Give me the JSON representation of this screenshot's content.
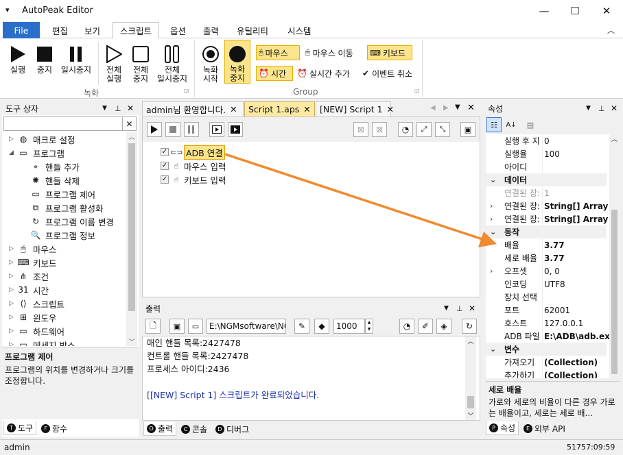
{
  "window": {
    "title": "AutoPeak Editor",
    "menu_glyph": "▾",
    "minimize": "—",
    "maximize": "☐",
    "close": "✕"
  },
  "ribbon_tabs": [
    "File",
    "편집",
    "보기",
    "스크립트",
    "옵션",
    "출력",
    "유틸리티",
    "시스템"
  ],
  "ribbon_collapse": "︿",
  "ribbon": {
    "run": "실행",
    "stop": "중지",
    "pause": "일시중지",
    "run_all": [
      "전체",
      "실행"
    ],
    "stop_all": [
      "전체",
      "중지"
    ],
    "pause_all": [
      "전체",
      "일시중지"
    ],
    "rec_start": [
      "녹화",
      "시작"
    ],
    "rec_stop": [
      "녹화",
      "중지"
    ],
    "group_record": "녹화",
    "mouse": "마우스",
    "mouse_move": "마우스 이동",
    "keyboard": "키보드",
    "time": "시간",
    "realtime_add": "실시간 추가",
    "event_cancel": "이벤트 취소",
    "group_group": "Group"
  },
  "toolbox": {
    "title": "도구 상자",
    "search_value": "",
    "items": [
      {
        "label": "매크로 설정",
        "level": 0,
        "arrow": "▷",
        "icon": "globe-icon",
        "glyph": "◍"
      },
      {
        "label": "프로그램",
        "level": 0,
        "arrow": "◢",
        "icon": "monitor-icon",
        "glyph": "▭"
      },
      {
        "label": "핸들 추가",
        "level": 1,
        "arrow": "",
        "icon": "crosshair-icon",
        "glyph": "⌖"
      },
      {
        "label": "핸들 삭제",
        "level": 1,
        "arrow": "",
        "icon": "target-delete-icon",
        "glyph": "✺"
      },
      {
        "label": "프로그램 제어",
        "level": 1,
        "arrow": "",
        "icon": "laptop-icon",
        "glyph": "▭"
      },
      {
        "label": "프로그램 활성화",
        "level": 1,
        "arrow": "",
        "icon": "window-activate-icon",
        "glyph": "⧉"
      },
      {
        "label": "프로그램 이름 변경",
        "level": 1,
        "arrow": "",
        "icon": "rename-icon",
        "glyph": "↻"
      },
      {
        "label": "프로그램 정보",
        "level": 1,
        "arrow": "",
        "icon": "magnifier-icon",
        "glyph": "🔍"
      },
      {
        "label": "마우스",
        "level": 0,
        "arrow": "▷",
        "icon": "mouse-icon",
        "glyph": "🖱"
      },
      {
        "label": "키보드",
        "level": 0,
        "arrow": "▷",
        "icon": "keyboard-icon",
        "glyph": "⌨"
      },
      {
        "label": "조건",
        "level": 0,
        "arrow": "▷",
        "icon": "condition-icon",
        "glyph": "⋔"
      },
      {
        "label": "시간",
        "level": 0,
        "arrow": "▷",
        "icon": "calendar-icon",
        "glyph": "31"
      },
      {
        "label": "스크립트",
        "level": 0,
        "arrow": "▷",
        "icon": "script-icon",
        "glyph": "⟨⟩"
      },
      {
        "label": "윈도우",
        "level": 0,
        "arrow": "▷",
        "icon": "windows-icon",
        "glyph": "⊞"
      },
      {
        "label": "하드웨어",
        "level": 0,
        "arrow": "▷",
        "icon": "hardware-icon",
        "glyph": "▭"
      },
      {
        "label": "메세지 박스",
        "level": 0,
        "arrow": "▷",
        "icon": "messagebox-icon",
        "glyph": "▭"
      }
    ],
    "desc_title": "프로그램 제어",
    "desc_text": "프로그램의 위치를 변경하거나 크기를 조정합니다.",
    "tabs": [
      {
        "label": "도구",
        "glyph": "T"
      },
      {
        "label": "함수",
        "glyph": "F"
      }
    ]
  },
  "doc_tabs": [
    "admin님 환영합니다.",
    "Script 1.aps",
    "[NEW] Script 1"
  ],
  "script": {
    "items": [
      {
        "label": "ADB 연결",
        "checked": true,
        "icon": "link-icon"
      },
      {
        "label": "마우스 입력",
        "checked": true,
        "icon": "hand-pointer-icon"
      },
      {
        "label": "키보드 입력",
        "checked": true,
        "icon": "hand-keyboard-icon"
      }
    ]
  },
  "output": {
    "title": "출력",
    "path": "E:\\NGMsoftware\\NG",
    "count": "1000",
    "lines": [
      "매인 핸들 목록:2427478",
      "컨트롤 핸들 목록:2427478",
      "프로세스 아이디:2436",
      "",
      "[[NEW] Script 1] 스크립트가 완료되었습니다."
    ],
    "tabs": [
      {
        "label": "출력",
        "glyph": "O"
      },
      {
        "label": "콘솔",
        "glyph": "C"
      },
      {
        "label": "디버그",
        "glyph": "D"
      }
    ]
  },
  "properties": {
    "title": "속성",
    "rows": [
      {
        "type": "prop",
        "name": "실행 후 지",
        "value": "0"
      },
      {
        "type": "prop",
        "name": "실행율",
        "value": "100"
      },
      {
        "type": "prop",
        "name": "아이디",
        "value": ""
      },
      {
        "type": "cat",
        "name": "데이터",
        "value": ""
      },
      {
        "type": "prop",
        "name": "연결된 장:",
        "value": "1",
        "dim": true
      },
      {
        "type": "prop",
        "name": "연결된 장:",
        "value": "String[] Array",
        "bold": true,
        "arrow": true
      },
      {
        "type": "prop",
        "name": "연결된 장:",
        "value": "String[] Array",
        "bold": true,
        "arrow": true
      },
      {
        "type": "cat",
        "name": "동작",
        "value": ""
      },
      {
        "type": "prop",
        "name": "배율",
        "value": "3.77",
        "bold": true
      },
      {
        "type": "prop",
        "name": "세로 배율",
        "value": "3.77",
        "bold": true
      },
      {
        "type": "prop",
        "name": "오프셋",
        "value": "0, 0",
        "arrow": true
      },
      {
        "type": "prop",
        "name": "인코딩",
        "value": "UTF8"
      },
      {
        "type": "prop",
        "name": "장치 선택",
        "value": ""
      },
      {
        "type": "prop",
        "name": "포트",
        "value": "62001"
      },
      {
        "type": "prop",
        "name": "호스트",
        "value": "127.0.0.1"
      },
      {
        "type": "prop",
        "name": "ADB 파일",
        "value": "E:\\ADB\\adb.exe",
        "bold": true
      },
      {
        "type": "cat",
        "name": "변수",
        "value": ""
      },
      {
        "type": "prop",
        "name": "가져오기",
        "value": "(Collection)",
        "bold": true
      },
      {
        "type": "prop",
        "name": "추가하기",
        "value": "(Collection)",
        "bold": true
      }
    ],
    "desc_title": "세로 배율",
    "desc_text": "가로와 세로의 비율이 다른 경우 가로는 배율이고, 세로는 세로 배...",
    "tabs": [
      {
        "label": "속성",
        "glyph": "P"
      },
      {
        "label": "외부 API",
        "glyph": "E"
      }
    ]
  },
  "status": {
    "user": "admin",
    "time": "51757:09:59"
  },
  "colors": {
    "accent": "#2a6fc9",
    "highlight": "#fbe48b",
    "arrow": "#f08a30"
  }
}
